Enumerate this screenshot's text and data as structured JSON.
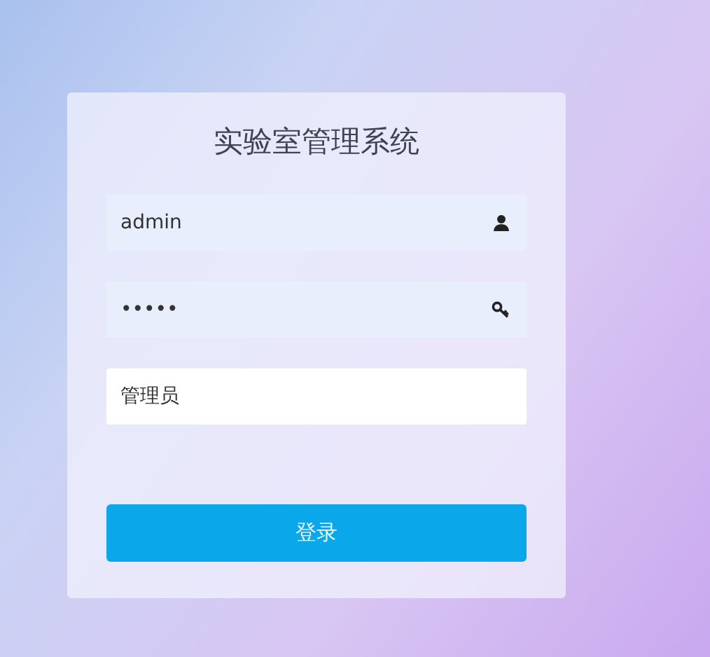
{
  "title": "实验室管理系统",
  "fields": [
    {
      "kind": "user",
      "value": "admin"
    },
    {
      "kind": "password",
      "value": "•••••"
    },
    {
      "kind": "plain",
      "value": "管理员"
    }
  ],
  "submit": {
    "label": "登录"
  }
}
